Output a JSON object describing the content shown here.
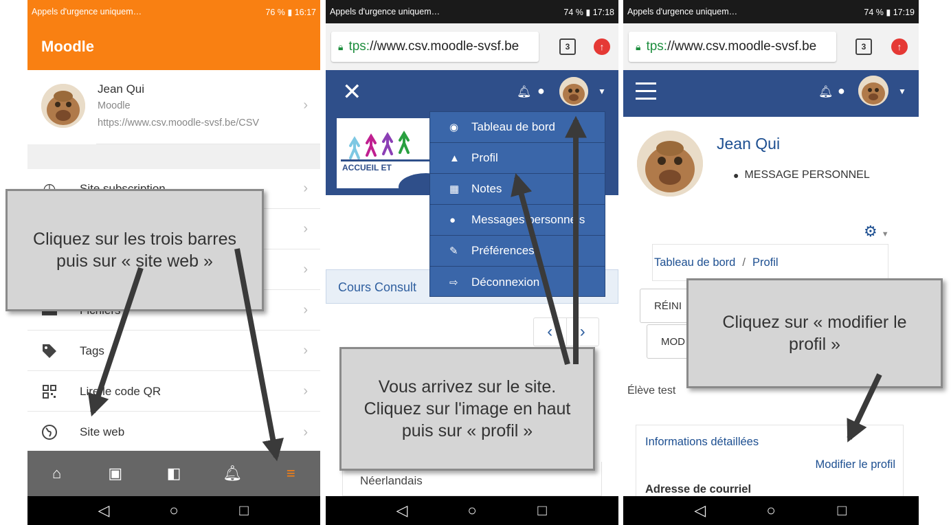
{
  "panel1": {
    "status": {
      "left": "Appels d'urgence uniquem…",
      "right": "76 % ▮ 16:17"
    },
    "header_title": "Moodle",
    "profile": {
      "name": "Jean Qui",
      "site": "Moodle",
      "url": "https://www.csv.moodle-svsf.be/CSV"
    },
    "menu": [
      {
        "label": "Site subscription",
        "icon": "clock-icon"
      },
      {
        "label": "",
        "icon": ""
      },
      {
        "label": "",
        "icon": ""
      },
      {
        "label": "Fichiers",
        "icon": "folder-icon"
      },
      {
        "label": "Tags",
        "icon": "tag-icon"
      },
      {
        "label": "Lire le code QR",
        "icon": "qr-icon"
      },
      {
        "label": "Site web",
        "icon": "globe-icon"
      }
    ],
    "callout": "Cliquez sur les trois barres puis sur « site web »",
    "colors": {
      "header": "#f98012",
      "tabbar": "#666666",
      "active_tab": "#f98012"
    }
  },
  "panel2": {
    "status": {
      "left": "Appels d'urgence uniquem…",
      "right": "74 % ▮ 17:18"
    },
    "url": {
      "scheme": "tps:",
      "rest": "//www.csv.moodle-svsf.be"
    },
    "tab_count": "3",
    "dropdown": [
      {
        "label": "Tableau de bord",
        "icon": "dashboard-icon"
      },
      {
        "label": "Profil",
        "icon": "user-icon"
      },
      {
        "label": "Notes",
        "icon": "table-icon"
      },
      {
        "label": "Messages personnels",
        "icon": "chat-icon"
      },
      {
        "label": "Préférences",
        "icon": "wrench-icon"
      },
      {
        "label": "Déconnexion",
        "icon": "logout-icon"
      }
    ],
    "logo_text": "ACCUEIL ET",
    "course_label": "Cours Consult",
    "list_item": "Néerlandais",
    "callout": "Vous arrivez sur le site. Cliquez sur l'image en haut puis sur « profil »",
    "colors": {
      "navbar": "#2f4f8a",
      "dropdown": "#3a66a9"
    }
  },
  "panel3": {
    "status": {
      "left": "Appels d'urgence uniquem…",
      "right": "74 % ▮ 17:19"
    },
    "url": {
      "scheme": "tps:",
      "rest": "//www.csv.moodle-svsf.be"
    },
    "tab_count": "3",
    "name": "Jean Qui",
    "message_button": "MESSAGE PERSONNEL",
    "breadcrumb": {
      "home": "Tableau de bord",
      "sep": "/",
      "current": "Profil"
    },
    "reset_button": "RÉINI",
    "modify_button": "MOD",
    "role": "Élève test",
    "details_title": "Informations détaillées",
    "edit_link": "Modifier le profil",
    "email_label": "Adresse de courriel",
    "callout": "Cliquez sur « modifier le profil »",
    "colors": {
      "navbar": "#2f4f8a",
      "link": "#1d4f91"
    }
  }
}
